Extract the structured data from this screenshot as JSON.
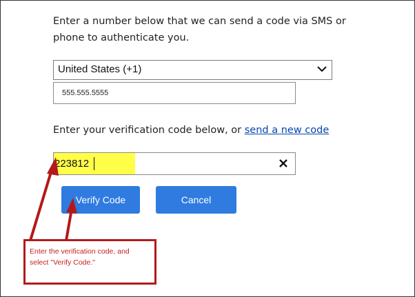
{
  "instructions": {
    "line1": "Enter a number below that we can send a code via SMS or",
    "line2": "phone to authenticate you."
  },
  "country_select": {
    "selected": "United States (+1)",
    "icon": "chevron-down-icon"
  },
  "phone_input": {
    "value": "555.555.5555"
  },
  "verification": {
    "prompt": "Enter your verification code below, or",
    "link": "send a new code"
  },
  "code_input": {
    "value": "223812",
    "clear_icon": "close-icon"
  },
  "buttons": {
    "verify": "Verify Code",
    "cancel": "Cancel"
  },
  "annotation": {
    "line1": "Enter the verification code, and",
    "line2": "select \"Verify Code.\""
  },
  "colors": {
    "button": "#2f7be0",
    "highlight": "#ffff4a",
    "annotation": "#b21a1a",
    "link": "#0645ad"
  }
}
